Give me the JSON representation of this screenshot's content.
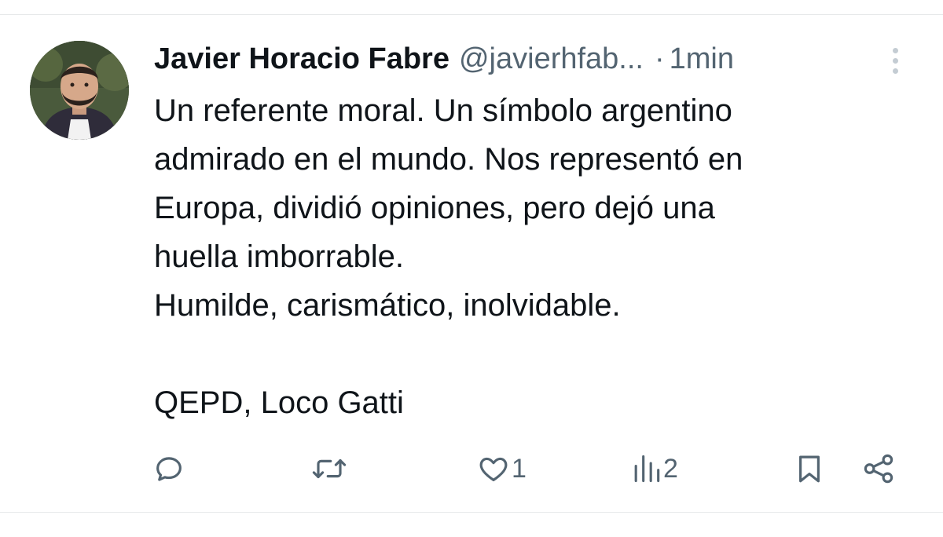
{
  "tweet": {
    "author": {
      "name": "Javier Horacio Fabre",
      "handle": "@javierhfab...",
      "avatar_icon": "profile-photo"
    },
    "separator": "·",
    "time": "1min",
    "more_icon": "more-vertical-icon",
    "text_lines": [
      "Un referente moral. Un símbolo argentino",
      "admirado en el mundo. Nos representó en",
      "Europa, dividió opiniones, pero dejó una",
      "huella imborrable.",
      "Humilde, carismático, inolvidable.",
      "",
      "QEPD, Loco Gatti"
    ],
    "actions": {
      "reply": {
        "icon": "reply-icon",
        "count": ""
      },
      "retweet": {
        "icon": "retweet-icon",
        "count": ""
      },
      "like": {
        "icon": "heart-icon",
        "count": "1"
      },
      "views": {
        "icon": "views-icon",
        "count": "2"
      },
      "bookmark": {
        "icon": "bookmark-icon"
      },
      "share": {
        "icon": "share-icon"
      }
    }
  },
  "colors": {
    "text": "#0f1419",
    "secondary": "#536471",
    "divider": "#e7e9ea"
  }
}
